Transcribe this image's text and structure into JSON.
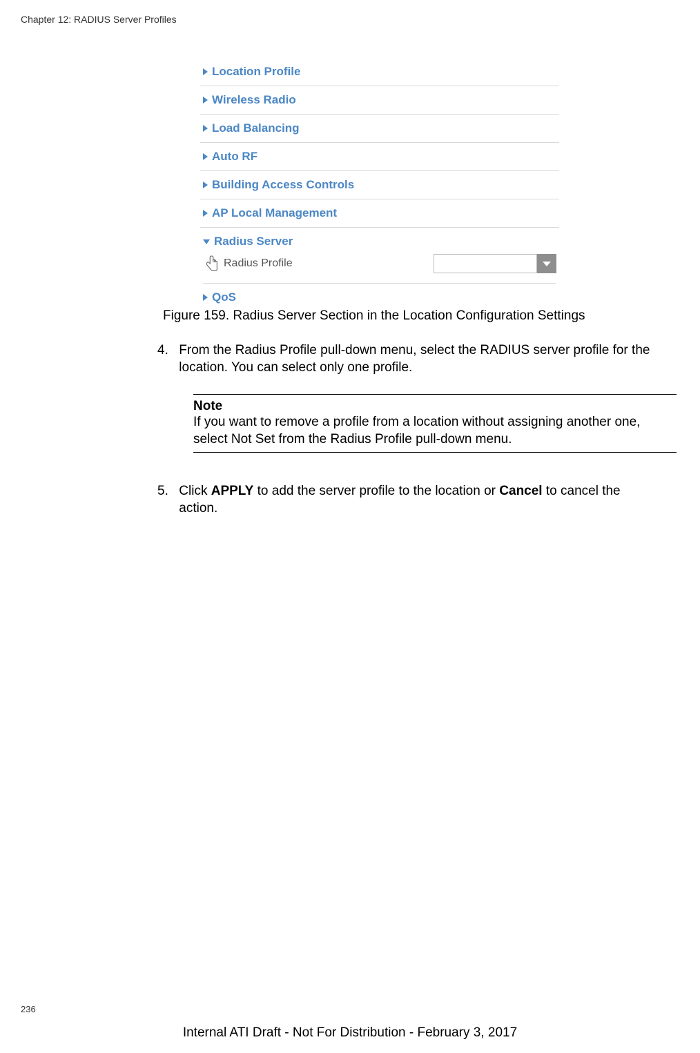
{
  "chapter_header": "Chapter 12: RADIUS Server Profiles",
  "accordion": {
    "items": [
      "Location Profile",
      "Wireless Radio",
      "Load Balancing",
      "Auto RF",
      "Building Access Controls",
      "AP Local Management"
    ],
    "radius_header": "Radius Server",
    "radius_profile_label": "Radius Profile",
    "qos": "QoS"
  },
  "figure_caption": "Figure 159. Radius Server Section in the Location Configuration Settings",
  "step4": {
    "num": "4.",
    "text": "From the Radius Profile pull-down menu, select the RADIUS server profile for the location. You can select only one profile."
  },
  "note": {
    "title": "Note",
    "text": "If you want to remove a profile from a location without assigning another one, select Not Set from the Radius Profile pull-down menu."
  },
  "step5": {
    "num": "5.",
    "prefix": "Click ",
    "bold1": "APPLY",
    "mid": " to add the server profile to the location or ",
    "bold2": "Cancel",
    "suffix": " to cancel the action."
  },
  "page_number": "236",
  "footer": "Internal ATI Draft - Not For Distribution - February 3, 2017"
}
